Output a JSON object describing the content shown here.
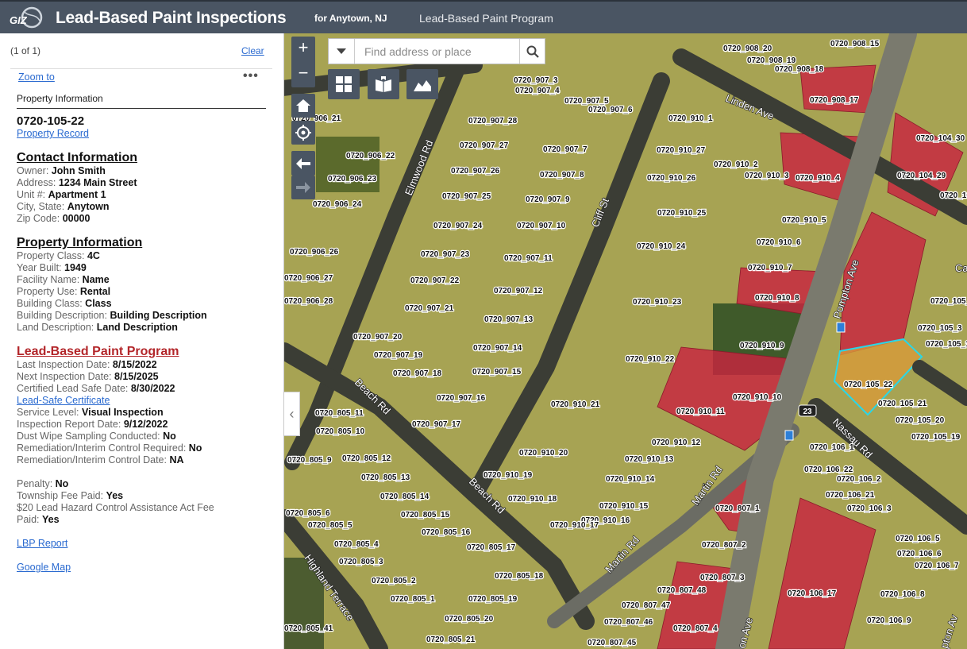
{
  "header": {
    "title": "Lead-Based Paint Inspections",
    "subtitle": "for Anytown, NJ",
    "program_link": "Lead-Based Paint Program",
    "logo_text": "GIZ"
  },
  "popup": {
    "pager": "(1 of 1)",
    "clear": "Clear",
    "zoom_to": "Zoom to",
    "more": "•••",
    "title": "Property Information",
    "parcel_id": "0720-105-22",
    "property_record": "Property Record",
    "contact": {
      "heading": "Contact Information",
      "owner_label": "Owner:",
      "owner": "John Smith",
      "address_label": "Address:",
      "address": "1234 Main Street",
      "unit_label": "Unit #:",
      "unit": "Apartment 1",
      "city_label": "City, State:",
      "city": "Anytown",
      "zip_label": "Zip Code:",
      "zip": "00000"
    },
    "property": {
      "heading": "Property Information",
      "class_label": "Property Class:",
      "class": "4C",
      "year_label": "Year Built:",
      "year": "1949",
      "facility_label": "Facility Name:",
      "facility": "Name",
      "use_label": "Property Use:",
      "use": "Rental",
      "bclass_label": "Building Class:",
      "bclass": "Class",
      "bdesc_label": "Building Description:",
      "bdesc": "Building Description",
      "ldesc_label": "Land Description:",
      "ldesc": "Land Description"
    },
    "lbp": {
      "heading": "Lead-Based Paint Program",
      "last_label": "Last Inspection Date:",
      "last": "8/15/2022",
      "next_label": "Next Inspection Date:",
      "next": "8/15/2025",
      "cert_label": "Certified Lead Safe Date:",
      "cert": "8/30/2022",
      "cert_link": "Lead-Safe Certificate",
      "service_label": "Service Level:",
      "service": "Visual Inspection",
      "report_label": "Inspection Report Date:",
      "report": "9/12/2022",
      "dust_label": "Dust Wipe Sampling Conducted:",
      "dust": "No",
      "remreq_label": "Remediation/Interim Control Required:",
      "remreq": "No",
      "remdate_label": "Remediation/Interim Control Date:",
      "remdate": "NA",
      "penalty_label": "Penalty:",
      "penalty": "No",
      "fee_label": "Township Fee Paid:",
      "fee": "Yes",
      "act_label_1": "$20 Lead Hazard Control Assistance Act Fee",
      "act_label_2": "Paid:",
      "act": "Yes",
      "report_link": "LBP Report",
      "map_link": "Google Map"
    }
  },
  "search": {
    "placeholder": "Find address or place"
  },
  "map": {
    "streets": {
      "linden": "Linden Ave",
      "elmwood": "Elmwood Rd",
      "cliff": "Cliff St",
      "pompton": "Pompton Ave",
      "pompton2": "on Ave",
      "beach1": "Beach Rd",
      "beach2": "Beach Rd",
      "nassau": "Nassau Rd",
      "martin1": "Martin Rd",
      "martin2": "Martin Rd",
      "highland": "Highland Terrace",
      "pompton3": "pton Av",
      "route": "23",
      "ca": "Ca"
    },
    "parcels": [
      "0720_908_15",
      "0720_908_20",
      "0720_908_19",
      "0720_908_18",
      "0720_908_17",
      "0720_907_3",
      "0720_907_4",
      "0720_907_5",
      "0720_907_6",
      "0720_906_21",
      "0720_907_28",
      "0720_910_1",
      "0720_104_30",
      "0720_907_27",
      "0720_907_7",
      "0720_910_27",
      "0720_906_22",
      "0720_910_2",
      "0720_910_3",
      "0720_910_4",
      "0720_104_29",
      "0720_906_23",
      "0720_907_26",
      "0720_907_8",
      "0720_910_26",
      "0720_907_25",
      "0720_907_9",
      "0720_906_24",
      "0720_910_25",
      "0720_910_5",
      "0720_907_24",
      "0720_907_10",
      "0720_910_6",
      "0720_910_24",
      "0720_906_26",
      "0720_907_23",
      "0720_907_11",
      "0720_910_7",
      "0720_906_27",
      "0720_907_22",
      "0720_910_8",
      "0720_907_12",
      "0720_105_2",
      "0720_907_21",
      "0720_910_23",
      "0720_907_13",
      "0720_105_3",
      "0720_907_20",
      "0720_910_9",
      "0720_907_14",
      "0720_907_19",
      "0720_910_22",
      "0720_907_18",
      "0720_907_15",
      "0720_105_22",
      "0720_910_10",
      "0720_907_16",
      "0720_105_21",
      "0720_910_21",
      "0720_805_11",
      "0720_910_11",
      "0720_105_20",
      "0720_907_17",
      "0720_805_10",
      "0720_910_12",
      "0720_105_19",
      "0720_106_1",
      "0720_910_20",
      "0720_805_9",
      "0720_805_12",
      "0720_910_13",
      "0720_106_22",
      "0720_805_13",
      "0720_910_19",
      "0720_910_14",
      "0720_106_2",
      "0720_805_14",
      "0720_910_18",
      "0720_106_21",
      "0720_805_6",
      "0720_805_15",
      "0720_910_15",
      "0720_807_1",
      "0720_106_3",
      "0720_805_5",
      "0720_910_16",
      "0720_805_16",
      "0720_910_17",
      "0720_106_5",
      "0720_805_4",
      "0720_805_17",
      "0720_807_2",
      "0720_106_6",
      "0720_805_3",
      "0720_106_7",
      "0720_805_18",
      "0720_807_3",
      "0720_805_2",
      "0720_807_48",
      "0720_106_17",
      "0720_106_8",
      "0720_805_1",
      "0720_805_19",
      "0720_807_47",
      "0720_805_20",
      "0720_807_46",
      "0720_106_9",
      "0720_805_41",
      "0720_807_4",
      "0720_805_21",
      "0720_807_45",
      "0720_106_10",
      "0720_906_28",
      "0720_105_10",
      "0720_105_1"
    ],
    "colors": {
      "parcel_fill": "#a7a353",
      "highlight": "#c8253f",
      "selected": "#d89a3a",
      "selected_outline": "#28d7e8",
      "road": "#3b3d35"
    }
  }
}
